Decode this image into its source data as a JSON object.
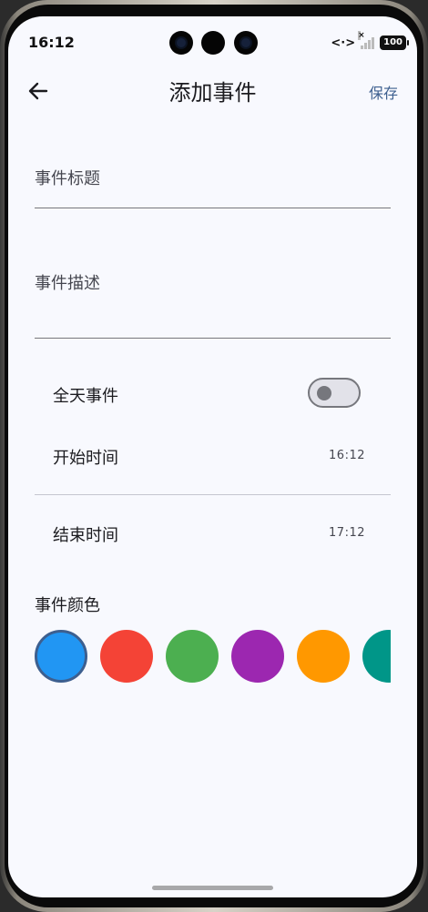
{
  "status_bar": {
    "time": "16:12",
    "data_icon": "<·>",
    "battery": "100"
  },
  "app_bar": {
    "back_icon": "arrow-back-icon",
    "title": "添加事件",
    "save_label": "保存"
  },
  "form": {
    "title_field": {
      "label": "事件标题",
      "value": ""
    },
    "description_field": {
      "label": "事件描述",
      "value": ""
    },
    "all_day": {
      "label": "全天事件",
      "enabled": false
    },
    "start": {
      "label": "开始时间",
      "value": "16:12"
    },
    "end": {
      "label": "结束时间",
      "value": "17:12"
    },
    "color_section": {
      "heading": "事件颜色",
      "colors": [
        "#2196f3",
        "#f44336",
        "#4caf50",
        "#9c27b0",
        "#ff9800",
        "#009688"
      ],
      "selected_index": 0
    }
  }
}
